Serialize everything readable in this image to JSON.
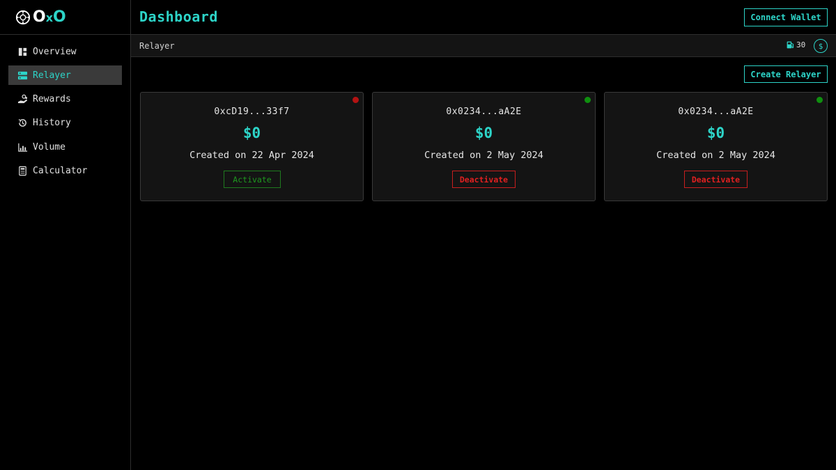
{
  "brand": {
    "name_part1": "O",
    "name_x": "x",
    "name_part2": "O"
  },
  "sidebar": {
    "items": [
      {
        "label": "Overview",
        "icon": "layout-icon"
      },
      {
        "label": "Relayer",
        "icon": "server-icon",
        "active": true
      },
      {
        "label": "Rewards",
        "icon": "hand-coins-icon"
      },
      {
        "label": "History",
        "icon": "history-icon"
      },
      {
        "label": "Volume",
        "icon": "bar-chart-icon"
      },
      {
        "label": "Calculator",
        "icon": "calculator-icon"
      }
    ]
  },
  "header": {
    "title": "Dashboard",
    "connect_label": "Connect Wallet"
  },
  "subbar": {
    "breadcrumb": "Relayer",
    "gas_value": "30",
    "coin_symbol": "$"
  },
  "main": {
    "create_label": "Create Relayer",
    "relayers": [
      {
        "address": "0xcD19...33f7",
        "amount": "$0",
        "created": "Created on 22 Apr 2024",
        "status_color": "#b31313",
        "action": "Activate"
      },
      {
        "address": "0x0234...aA2E",
        "amount": "$0",
        "created": "Created on 2 May 2024",
        "status_color": "#0f8f0f",
        "action": "Deactivate"
      },
      {
        "address": "0x0234...aA2E",
        "amount": "$0",
        "created": "Created on 2 May 2024",
        "status_color": "#0f8f0f",
        "action": "Deactivate"
      }
    ]
  },
  "colors": {
    "accent": "#2dd4c8",
    "danger": "#e02020",
    "success": "#1f9a1f"
  }
}
